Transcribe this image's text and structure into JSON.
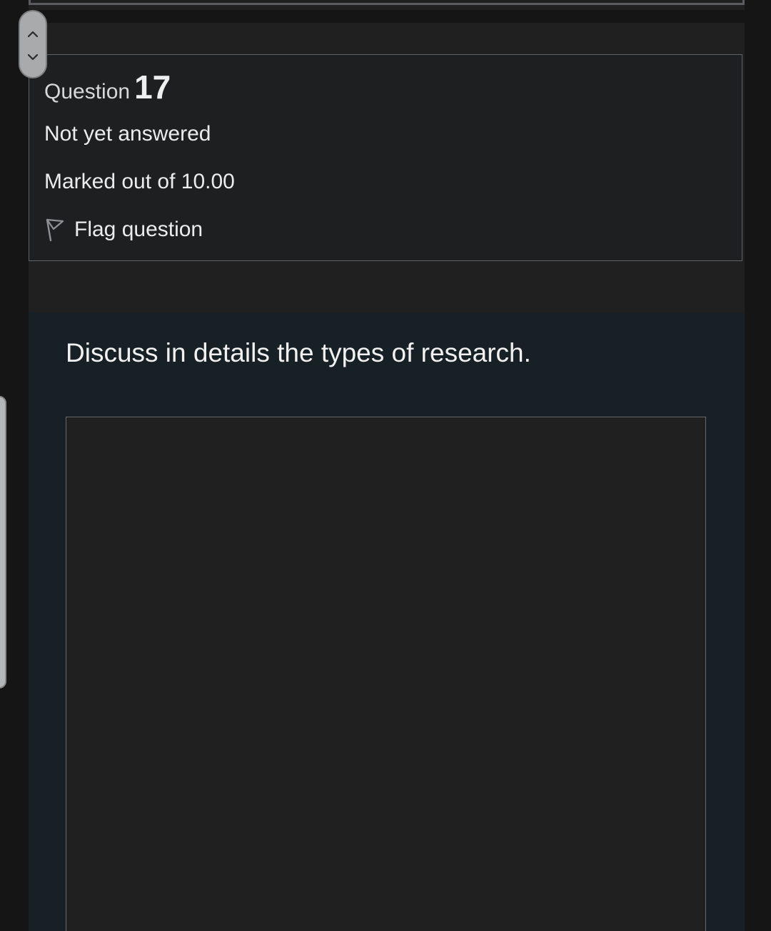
{
  "question": {
    "label": "Question",
    "number": "17",
    "status": "Not yet answered",
    "marks": "Marked out of 10.00",
    "flag_label": "Flag question",
    "text": "Discuss in details the types of research.",
    "answer_value": ""
  },
  "icons": {
    "flag": "flag-outline-icon",
    "nav_up": "chevron-up-icon",
    "nav_down": "chevron-down-icon"
  },
  "colors": {
    "page_background": "#151515",
    "panel_background": "#202020",
    "question_panel_background": "#172024",
    "border": "#5f6266",
    "text": "#ececec"
  }
}
